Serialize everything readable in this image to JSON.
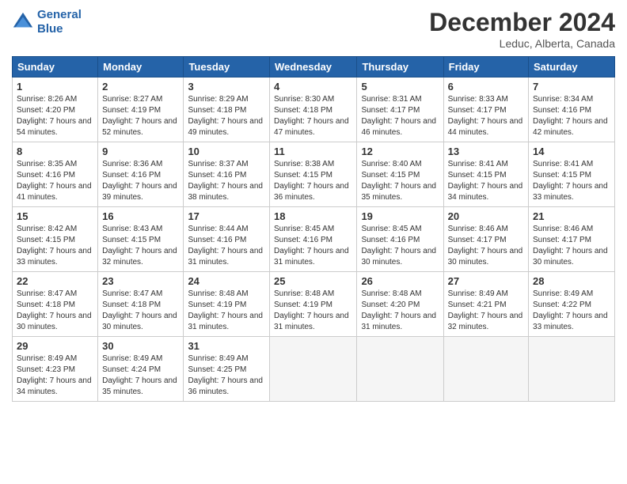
{
  "header": {
    "logo_line1": "General",
    "logo_line2": "Blue",
    "month": "December 2024",
    "location": "Leduc, Alberta, Canada"
  },
  "weekdays": [
    "Sunday",
    "Monday",
    "Tuesday",
    "Wednesday",
    "Thursday",
    "Friday",
    "Saturday"
  ],
  "weeks": [
    [
      {
        "day": "1",
        "sunrise": "8:26 AM",
        "sunset": "4:20 PM",
        "daylight": "7 hours and 54 minutes."
      },
      {
        "day": "2",
        "sunrise": "8:27 AM",
        "sunset": "4:19 PM",
        "daylight": "7 hours and 52 minutes."
      },
      {
        "day": "3",
        "sunrise": "8:29 AM",
        "sunset": "4:18 PM",
        "daylight": "7 hours and 49 minutes."
      },
      {
        "day": "4",
        "sunrise": "8:30 AM",
        "sunset": "4:18 PM",
        "daylight": "7 hours and 47 minutes."
      },
      {
        "day": "5",
        "sunrise": "8:31 AM",
        "sunset": "4:17 PM",
        "daylight": "7 hours and 46 minutes."
      },
      {
        "day": "6",
        "sunrise": "8:33 AM",
        "sunset": "4:17 PM",
        "daylight": "7 hours and 44 minutes."
      },
      {
        "day": "7",
        "sunrise": "8:34 AM",
        "sunset": "4:16 PM",
        "daylight": "7 hours and 42 minutes."
      }
    ],
    [
      {
        "day": "8",
        "sunrise": "8:35 AM",
        "sunset": "4:16 PM",
        "daylight": "7 hours and 41 minutes."
      },
      {
        "day": "9",
        "sunrise": "8:36 AM",
        "sunset": "4:16 PM",
        "daylight": "7 hours and 39 minutes."
      },
      {
        "day": "10",
        "sunrise": "8:37 AM",
        "sunset": "4:16 PM",
        "daylight": "7 hours and 38 minutes."
      },
      {
        "day": "11",
        "sunrise": "8:38 AM",
        "sunset": "4:15 PM",
        "daylight": "7 hours and 36 minutes."
      },
      {
        "day": "12",
        "sunrise": "8:40 AM",
        "sunset": "4:15 PM",
        "daylight": "7 hours and 35 minutes."
      },
      {
        "day": "13",
        "sunrise": "8:41 AM",
        "sunset": "4:15 PM",
        "daylight": "7 hours and 34 minutes."
      },
      {
        "day": "14",
        "sunrise": "8:41 AM",
        "sunset": "4:15 PM",
        "daylight": "7 hours and 33 minutes."
      }
    ],
    [
      {
        "day": "15",
        "sunrise": "8:42 AM",
        "sunset": "4:15 PM",
        "daylight": "7 hours and 33 minutes."
      },
      {
        "day": "16",
        "sunrise": "8:43 AM",
        "sunset": "4:15 PM",
        "daylight": "7 hours and 32 minutes."
      },
      {
        "day": "17",
        "sunrise": "8:44 AM",
        "sunset": "4:16 PM",
        "daylight": "7 hours and 31 minutes."
      },
      {
        "day": "18",
        "sunrise": "8:45 AM",
        "sunset": "4:16 PM",
        "daylight": "7 hours and 31 minutes."
      },
      {
        "day": "19",
        "sunrise": "8:45 AM",
        "sunset": "4:16 PM",
        "daylight": "7 hours and 30 minutes."
      },
      {
        "day": "20",
        "sunrise": "8:46 AM",
        "sunset": "4:17 PM",
        "daylight": "7 hours and 30 minutes."
      },
      {
        "day": "21",
        "sunrise": "8:46 AM",
        "sunset": "4:17 PM",
        "daylight": "7 hours and 30 minutes."
      }
    ],
    [
      {
        "day": "22",
        "sunrise": "8:47 AM",
        "sunset": "4:18 PM",
        "daylight": "7 hours and 30 minutes."
      },
      {
        "day": "23",
        "sunrise": "8:47 AM",
        "sunset": "4:18 PM",
        "daylight": "7 hours and 30 minutes."
      },
      {
        "day": "24",
        "sunrise": "8:48 AM",
        "sunset": "4:19 PM",
        "daylight": "7 hours and 31 minutes."
      },
      {
        "day": "25",
        "sunrise": "8:48 AM",
        "sunset": "4:19 PM",
        "daylight": "7 hours and 31 minutes."
      },
      {
        "day": "26",
        "sunrise": "8:48 AM",
        "sunset": "4:20 PM",
        "daylight": "7 hours and 31 minutes."
      },
      {
        "day": "27",
        "sunrise": "8:49 AM",
        "sunset": "4:21 PM",
        "daylight": "7 hours and 32 minutes."
      },
      {
        "day": "28",
        "sunrise": "8:49 AM",
        "sunset": "4:22 PM",
        "daylight": "7 hours and 33 minutes."
      }
    ],
    [
      {
        "day": "29",
        "sunrise": "8:49 AM",
        "sunset": "4:23 PM",
        "daylight": "7 hours and 34 minutes."
      },
      {
        "day": "30",
        "sunrise": "8:49 AM",
        "sunset": "4:24 PM",
        "daylight": "7 hours and 35 minutes."
      },
      {
        "day": "31",
        "sunrise": "8:49 AM",
        "sunset": "4:25 PM",
        "daylight": "7 hours and 36 minutes."
      },
      null,
      null,
      null,
      null
    ]
  ]
}
